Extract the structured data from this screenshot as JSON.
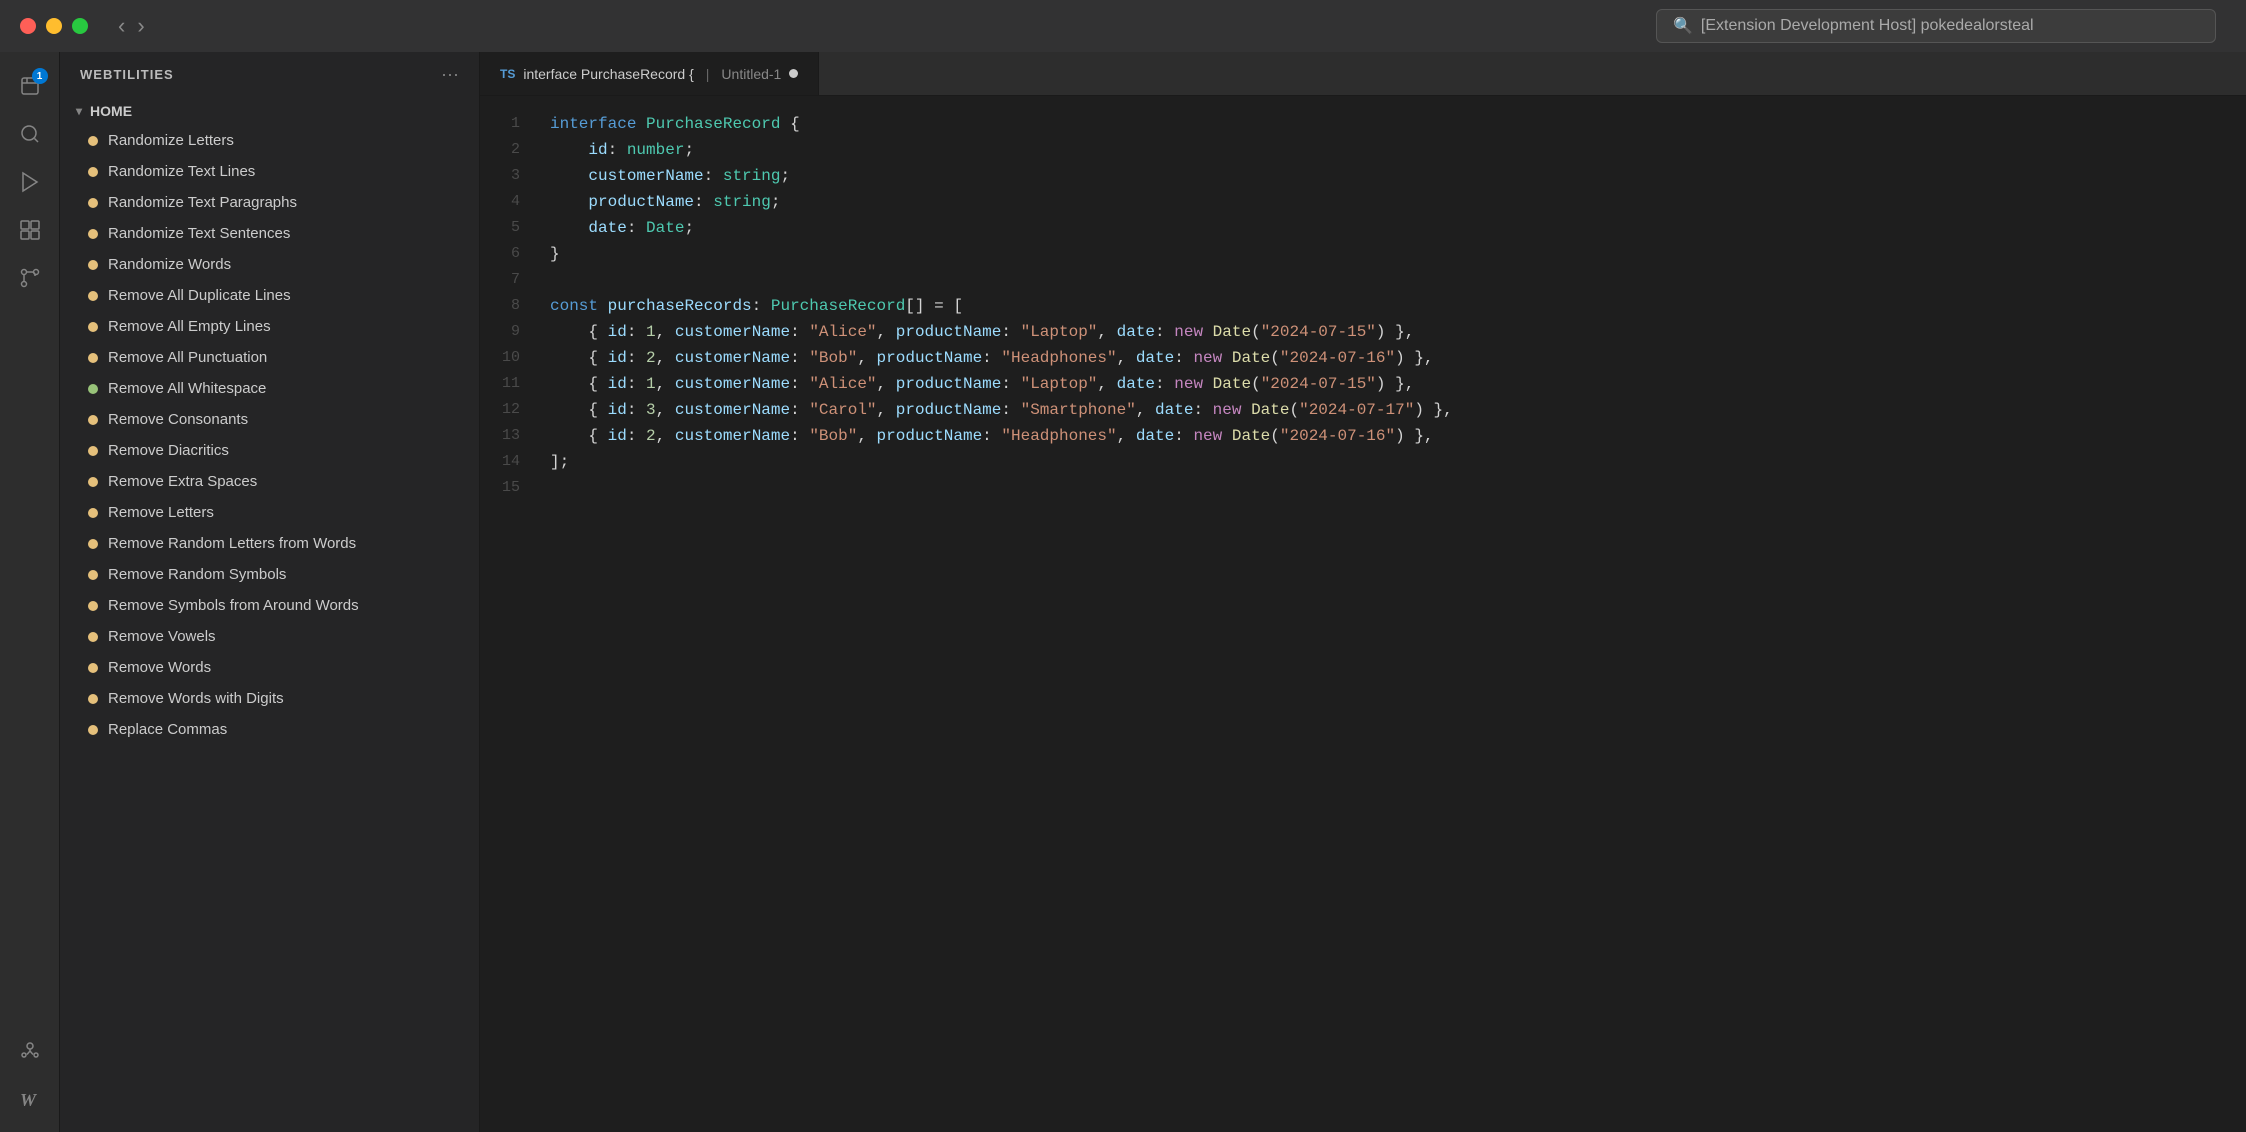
{
  "titleBar": {
    "searchPlaceholder": "[Extension Development Host] pokedealorsteal"
  },
  "sidebar": {
    "title": "WEBTILITIES",
    "sectionLabel": "HOME",
    "items": [
      {
        "label": "Randomize Letters",
        "dot": "yellow"
      },
      {
        "label": "Randomize Text Lines",
        "dot": "yellow"
      },
      {
        "label": "Randomize Text Paragraphs",
        "dot": "yellow"
      },
      {
        "label": "Randomize Text Sentences",
        "dot": "yellow"
      },
      {
        "label": "Randomize Words",
        "dot": "yellow"
      },
      {
        "label": "Remove All Duplicate Lines",
        "dot": "yellow"
      },
      {
        "label": "Remove All Empty Lines",
        "dot": "yellow"
      },
      {
        "label": "Remove All Punctuation",
        "dot": "yellow"
      },
      {
        "label": "Remove All Whitespace",
        "dot": "green"
      },
      {
        "label": "Remove Consonants",
        "dot": "yellow"
      },
      {
        "label": "Remove Diacritics",
        "dot": "yellow"
      },
      {
        "label": "Remove Extra Spaces",
        "dot": "yellow"
      },
      {
        "label": "Remove Letters",
        "dot": "yellow"
      },
      {
        "label": "Remove Random Letters from Words",
        "dot": "yellow"
      },
      {
        "label": "Remove Random Symbols",
        "dot": "yellow"
      },
      {
        "label": "Remove Symbols from Around Words",
        "dot": "yellow"
      },
      {
        "label": "Remove Vowels",
        "dot": "yellow"
      },
      {
        "label": "Remove Words",
        "dot": "yellow"
      },
      {
        "label": "Remove Words with Digits",
        "dot": "yellow"
      },
      {
        "label": "Replace Commas",
        "dot": "yellow"
      }
    ]
  },
  "tab": {
    "languageBadge": "TS",
    "filename": "interface PurchaseRecord {",
    "secondFile": "Untitled-1"
  },
  "codeLines": [
    {
      "num": 1,
      "text": "interface PurchaseRecord {"
    },
    {
      "num": 2,
      "text": "    id: number;"
    },
    {
      "num": 3,
      "text": "    customerName: string;"
    },
    {
      "num": 4,
      "text": "    productName: string;"
    },
    {
      "num": 5,
      "text": "    date: Date;"
    },
    {
      "num": 6,
      "text": "}"
    },
    {
      "num": 7,
      "text": ""
    },
    {
      "num": 8,
      "text": "const purchaseRecords: PurchaseRecord[] = ["
    },
    {
      "num": 9,
      "text": "    { id: 1, customerName: \"Alice\", productName: \"Laptop\", date: new Date(\"2024-07-15\") },"
    },
    {
      "num": 10,
      "text": "    { id: 2, customerName: \"Bob\", productName: \"Headphones\", date: new Date(\"2024-07-16\") },"
    },
    {
      "num": 11,
      "text": "    { id: 1, customerName: \"Alice\", productName: \"Laptop\", date: new Date(\"2024-07-15\") },"
    },
    {
      "num": 12,
      "text": "    { id: 3, customerName: \"Carol\", productName: \"Smartphone\", date: new Date(\"2024-07-17\") },"
    },
    {
      "num": 13,
      "text": "    { id: 2, customerName: \"Bob\", productName: \"Headphones\", date: new Date(\"2024-07-16\") },"
    },
    {
      "num": 14,
      "text": "];"
    },
    {
      "num": 15,
      "text": ""
    }
  ],
  "activityIcons": {
    "explorer": "📄",
    "search": "🔍",
    "sourceControl": "▶",
    "debug": "🔴",
    "extensions": "⊞",
    "gitLens": "🔀",
    "webtilities": "𝓦"
  },
  "badge": "1"
}
